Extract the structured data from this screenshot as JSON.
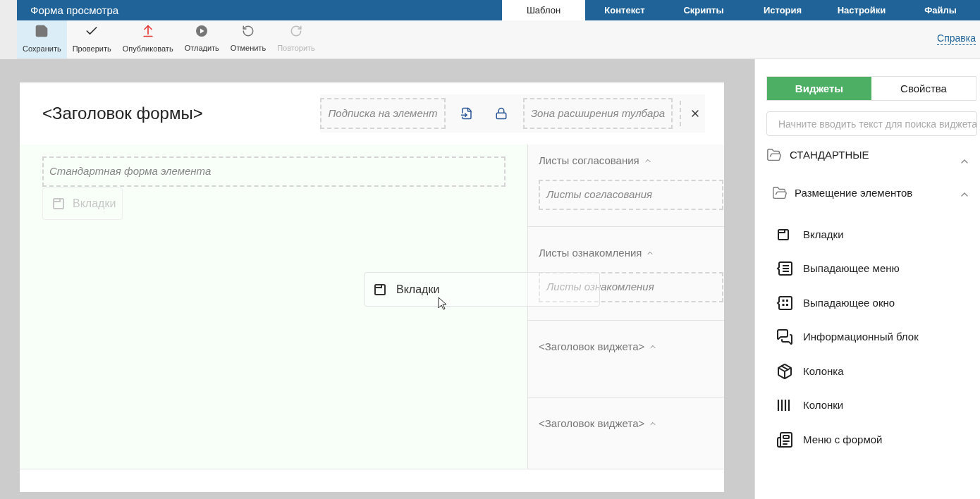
{
  "app": {
    "title": "Форма просмотра"
  },
  "tabs": [
    {
      "label": "Шаблон",
      "selected": true
    },
    {
      "label": "Контекст",
      "selected": false
    },
    {
      "label": "Скрипты",
      "selected": false
    },
    {
      "label": "История",
      "selected": false
    },
    {
      "label": "Настройки",
      "selected": false
    },
    {
      "label": "Файлы",
      "selected": false
    }
  ],
  "toolbar": [
    {
      "kind": "save",
      "label": "Сохранить",
      "highlighted": true,
      "disabled": false
    },
    {
      "kind": "check",
      "label": "Проверить",
      "highlighted": false,
      "disabled": false
    },
    {
      "kind": "publish",
      "label": "Опубликовать",
      "highlighted": false,
      "disabled": false
    },
    {
      "kind": "debug",
      "label": "Отладить",
      "highlighted": false,
      "disabled": false
    },
    {
      "kind": "undo",
      "label": "Отменить",
      "highlighted": false,
      "disabled": false
    },
    {
      "kind": "redo",
      "label": "Повторить",
      "highlighted": false,
      "disabled": true
    }
  ],
  "help_link": "Справка",
  "form": {
    "title": "<Заголовок формы>",
    "subscription_zone": "Подписка на элемент",
    "toolbar_zone": "Зона расширения тулбара",
    "main_zone": "Стандартная форма элемента",
    "drop_ghost": "Вкладки",
    "side_sections": [
      {
        "title": "Листы согласования",
        "placeholder": "Листы согласования"
      },
      {
        "title": "Листы ознакомления",
        "placeholder": "Листы ознакомления"
      },
      {
        "title": "<Заголовок виджета>"
      },
      {
        "title": "<Заголовок виджета>"
      }
    ],
    "dragged_item": "Вкладки"
  },
  "panel": {
    "tabs": [
      {
        "label": "Виджеты",
        "selected": true
      },
      {
        "label": "Свойства",
        "selected": false
      }
    ],
    "search": {
      "placeholder": "Начните вводить текст для поиска виджета"
    },
    "tree": [
      {
        "label": "СТАНДАРТНЫЕ",
        "expanded": true,
        "children": [
          {
            "label": "Размещение элементов",
            "expanded": true,
            "children": [
              {
                "kind": "tabs",
                "label": "Вкладки"
              },
              {
                "kind": "dropdown-menu",
                "label": "Выпадающее меню"
              },
              {
                "kind": "dropdown-window",
                "label": "Выпадающее окно"
              },
              {
                "kind": "info-block",
                "label": "Информационный блок"
              },
              {
                "kind": "column",
                "label": "Колонка"
              },
              {
                "kind": "columns",
                "label": "Колонки"
              },
              {
                "kind": "menu-form",
                "label": "Меню с формой"
              }
            ]
          }
        ]
      }
    ]
  }
}
